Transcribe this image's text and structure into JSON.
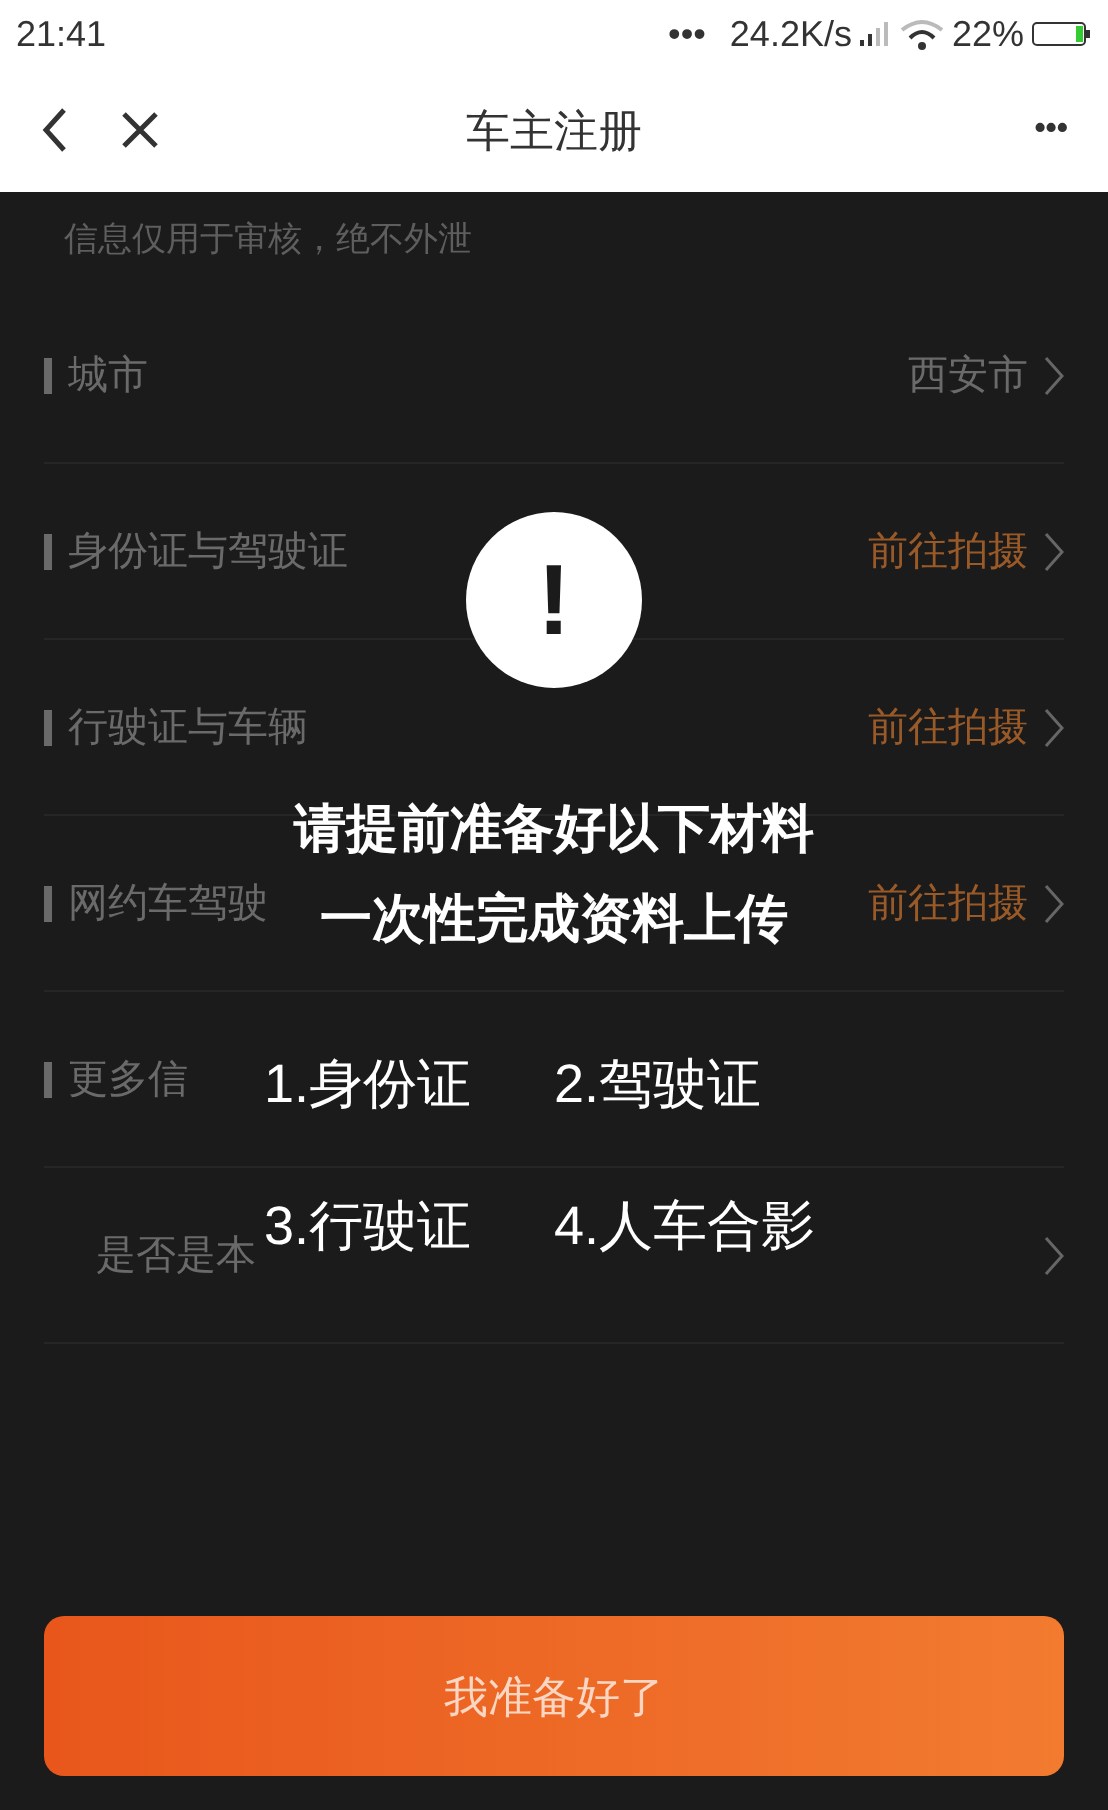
{
  "status_bar": {
    "time": "21:41",
    "dots": "•••",
    "speed": "24.2K/s",
    "battery": "22%"
  },
  "nav": {
    "title": "车主注册",
    "more": "•••"
  },
  "form": {
    "hint": "信息仅用于审核，绝不外泄",
    "rows": [
      {
        "kind": "value",
        "label": "城市",
        "value": "西安市"
      },
      {
        "kind": "action",
        "label": "身份证与驾驶证",
        "value": "前往拍摄"
      },
      {
        "kind": "action",
        "label": "行驶证与车辆",
        "value": "前往拍摄"
      },
      {
        "kind": "action",
        "label": "网约车驾驶",
        "value": "前往拍摄"
      },
      {
        "kind": "section",
        "label": "更多信"
      },
      {
        "kind": "sub",
        "label": "是否是本"
      }
    ]
  },
  "dialog": {
    "mark": "!",
    "title_lines": [
      "请提前准备好以下材料",
      "一次性完成资料上传"
    ],
    "materials": [
      [
        "1.身份证",
        "2.驾驶证"
      ],
      [
        "3.行驶证",
        "4.人车合影"
      ]
    ]
  },
  "confirm_button": "我准备好了"
}
